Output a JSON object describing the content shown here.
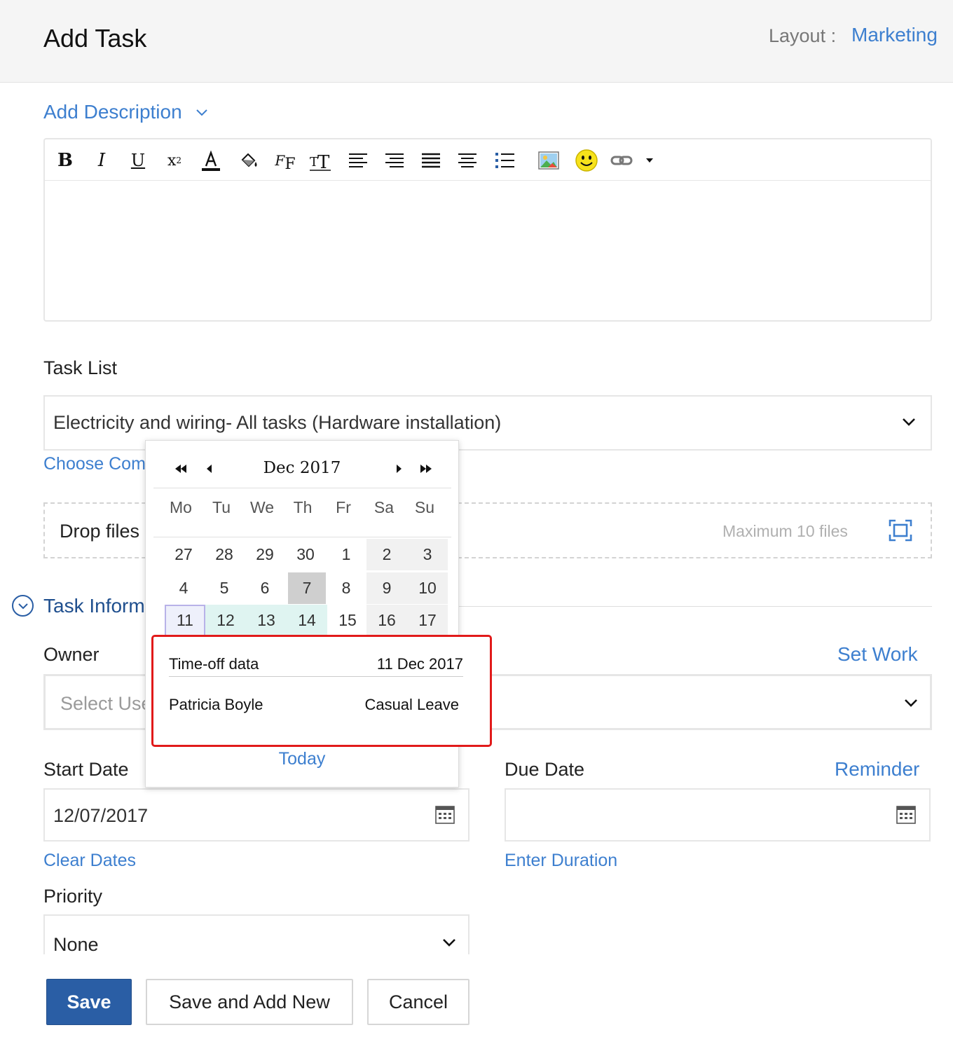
{
  "header": {
    "title": "Add Task",
    "layout_label": "Layout :",
    "layout_value": "Marketing"
  },
  "description": {
    "label": "Add Description"
  },
  "editor": {
    "toolbar": [
      "bold-icon",
      "italic-icon",
      "underline-icon",
      "superscript-icon",
      "font-color-icon",
      "background-color-icon",
      "font-family-icon",
      "font-size-icon",
      "align-left-icon",
      "align-right-icon",
      "justify-icon",
      "align-center-icon",
      "bullet-list-icon",
      "insert-image-icon",
      "emoji-icon",
      "insert-link-icon",
      "more-dropdown-icon"
    ]
  },
  "task_list": {
    "label": "Task List",
    "value": "Electricity and wiring- All tasks (Hardware installation)",
    "choose_link": "Choose Comp"
  },
  "attachments": {
    "drop_text": "Drop files",
    "max_text": "Maximum 10 files"
  },
  "section": {
    "title": "Task Inform"
  },
  "owner": {
    "label": "Owner",
    "set_work": "Set Work",
    "placeholder": "Select Use"
  },
  "start_date": {
    "label": "Start Date",
    "value": "12/07/2017",
    "clear_link": "Clear Dates"
  },
  "due_date": {
    "label": "Due Date",
    "reminder": "Reminder",
    "value": "",
    "duration_link": "Enter Duration"
  },
  "priority": {
    "label": "Priority",
    "value": "None"
  },
  "buttons": {
    "save": "Save",
    "save_new": "Save and Add New",
    "cancel": "Cancel"
  },
  "datepicker": {
    "month": "Dec 2017",
    "dow": [
      "Mo",
      "Tu",
      "We",
      "Th",
      "Fr",
      "Sa",
      "Su"
    ],
    "weeks": [
      [
        "27",
        "28",
        "29",
        "30",
        "1",
        "2",
        "3"
      ],
      [
        "4",
        "5",
        "6",
        "7",
        "8",
        "9",
        "10"
      ],
      [
        "11",
        "12",
        "13",
        "14",
        "15",
        "16",
        "17"
      ]
    ],
    "today_label": "Today"
  },
  "timeoff": {
    "title": "Time-off data",
    "date": "11 Dec 2017",
    "name": "Patricia Boyle",
    "type": "Casual Leave"
  },
  "colors": {
    "link": "#3d7fcf",
    "primary": "#2a5ea5",
    "highlight": "#e11a1a"
  }
}
